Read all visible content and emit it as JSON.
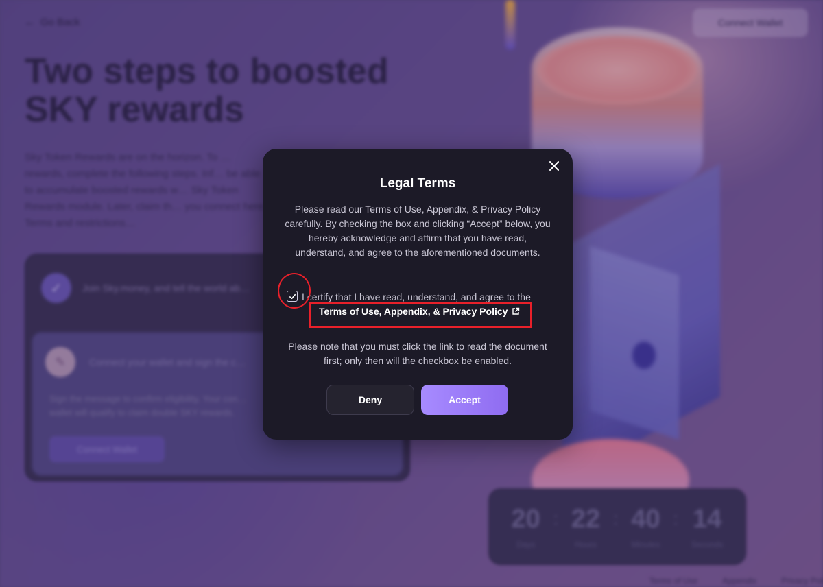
{
  "background": {
    "go_back_label": "Go Back",
    "connect_wallet_label": "Connect Wallet",
    "hero_title": "Two steps to boosted SKY rewards",
    "hero_description": "Sky Token Rewards are on the horizon. To … rewards, complete the following steps. Inf… be able to accumulate boosted rewards w… Sky Token Rewards module. Later, claim th… you connect here. Terms and restrictions…",
    "step1_text": "Join Sky.money, and tell the world ab…",
    "step2_title": "Connect your wallet and sign the c…",
    "step2_text": "Sign the message to confirm eligibility. Your con… wallet will qualify to claim double SKY rewards.",
    "step2_button": "Connect Wallet",
    "countdown": [
      {
        "value": "20",
        "label": "Days"
      },
      {
        "value": "22",
        "label": "Hours"
      },
      {
        "value": "40",
        "label": "Minutes"
      },
      {
        "value": "14",
        "label": "Seconds"
      }
    ],
    "footer_links": [
      "Terms of Use",
      "Appendix",
      "Privacy Policy"
    ]
  },
  "modal": {
    "title": "Legal Terms",
    "description": "Please read our Terms of Use, Appendix, & Privacy Policy carefully. By checking the box and clicking “Accept” below, you hereby acknowledge and affirm that you have read, understand, and agree to the aforementioned documents.",
    "certify_text": "I certify that I have read, understand, and agree to the",
    "terms_link": "Terms of Use, Appendix, & Privacy Policy",
    "note": "Please note that you must click the link to read the document first; only then will the checkbox be enabled.",
    "deny_label": "Deny",
    "accept_label": "Accept",
    "checkbox_checked": true
  },
  "colors": {
    "modal_bg": "#1c1a27",
    "accent": "#9a7bf8",
    "annotation": "#e8202a"
  }
}
